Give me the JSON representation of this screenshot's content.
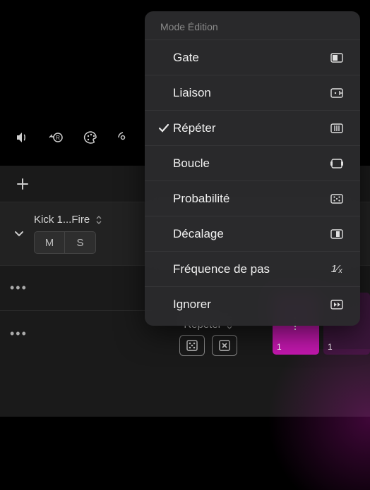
{
  "menu": {
    "header": "Mode Édition",
    "items": [
      {
        "label": "Gate",
        "icon": "gate",
        "checked": false
      },
      {
        "label": "Liaison",
        "icon": "tie",
        "checked": false
      },
      {
        "label": "Répéter",
        "icon": "repeat",
        "checked": true
      },
      {
        "label": "Boucle",
        "icon": "loop",
        "checked": false
      },
      {
        "label": "Probabilité",
        "icon": "probability",
        "checked": false
      },
      {
        "label": "Décalage",
        "icon": "offset",
        "checked": false
      },
      {
        "label": "Fréquence de pas",
        "icon": "rate",
        "checked": false
      },
      {
        "label": "Ignorer",
        "icon": "skip",
        "checked": false
      }
    ]
  },
  "track": {
    "name": "Kick 1...Fire",
    "mute_label": "M",
    "solo_label": "S"
  },
  "bottom": {
    "mode_label": "Répéter"
  },
  "steps": [
    {
      "value": "1",
      "active": true
    },
    {
      "value": "1",
      "active": false
    }
  ],
  "colors": {
    "accent": "#c518b0"
  }
}
